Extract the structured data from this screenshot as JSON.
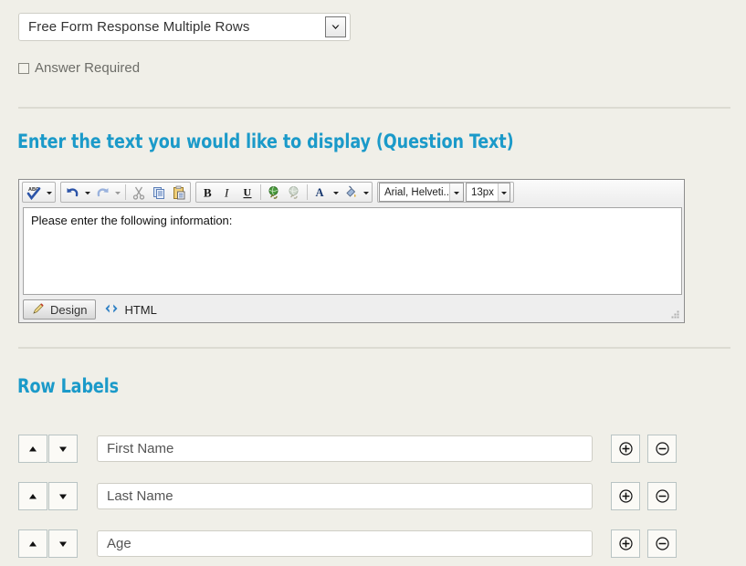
{
  "question_type": {
    "selected": "Free Form Response Multiple Rows",
    "icon": "chevron-down-icon"
  },
  "answer_required": {
    "label": "Answer Required",
    "checked": false
  },
  "sections": {
    "question_text_heading": "Enter the text you would like to display (Question Text)",
    "row_labels_heading": "Row Labels"
  },
  "editor": {
    "content": "Please enter the following information:",
    "font_family": "Arial, Helveti...",
    "font_size": "13px",
    "toolbar": [
      {
        "name": "spellcheck-icon",
        "title": "Spell Check"
      },
      {
        "name": "undo-icon",
        "title": "Undo"
      },
      {
        "name": "redo-icon",
        "title": "Redo"
      },
      {
        "name": "cut-icon",
        "title": "Cut"
      },
      {
        "name": "copy-icon",
        "title": "Copy"
      },
      {
        "name": "paste-icon",
        "title": "Paste"
      },
      {
        "name": "bold-icon",
        "title": "Bold",
        "glyph": "B"
      },
      {
        "name": "italic-icon",
        "title": "Italic",
        "glyph": "I"
      },
      {
        "name": "underline-icon",
        "title": "Underline",
        "glyph": "U"
      },
      {
        "name": "insert-link-icon",
        "title": "Insert Link"
      },
      {
        "name": "remove-link-icon",
        "title": "Remove Link"
      },
      {
        "name": "font-color-icon",
        "title": "Font Color",
        "glyph": "A"
      },
      {
        "name": "highlight-color-icon",
        "title": "Highlight Color"
      }
    ],
    "tabs": [
      {
        "label": "Design",
        "icon": "pencil-icon",
        "active": true
      },
      {
        "label": "HTML",
        "icon": "code-icon",
        "active": false
      }
    ]
  },
  "row_labels": {
    "rows": [
      {
        "value": "First Name"
      },
      {
        "value": "Last Name"
      },
      {
        "value": "Age"
      }
    ],
    "buttons": {
      "move_up": "move-up-icon",
      "move_down": "move-down-icon",
      "add": "add-row-icon",
      "remove": "remove-row-icon"
    }
  },
  "colors": {
    "page_background": "#f0efe8",
    "heading": "#1b9ac9",
    "divider": "#dcdbd2",
    "input_border": "#cfcec6",
    "muted_text": "#6d6d68"
  }
}
